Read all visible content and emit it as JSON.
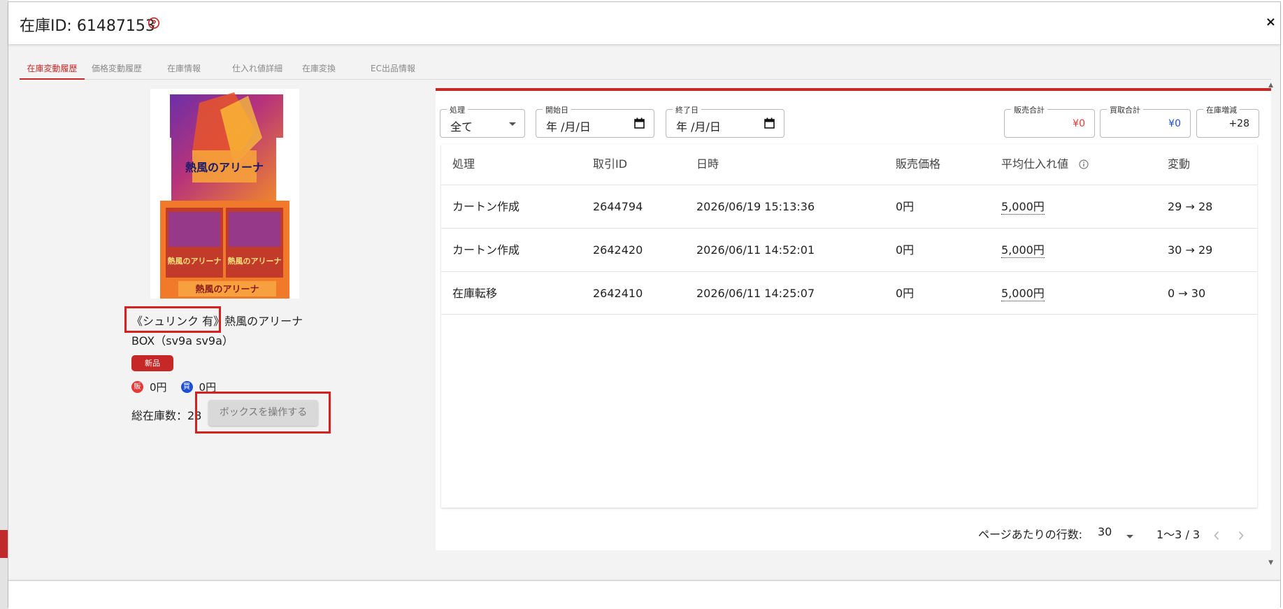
{
  "header": {
    "title": "在庫ID: 61487153",
    "close_label": "×"
  },
  "tabs": [
    {
      "label": "在庫変動履歴",
      "active": true
    },
    {
      "label": "価格変動履歴",
      "active": false
    },
    {
      "label": "在庫情報",
      "active": false
    },
    {
      "label": "仕入れ値詳細",
      "active": false
    },
    {
      "label": "在庫変換",
      "active": false
    },
    {
      "label": "EC出品情報",
      "active": false
    }
  ],
  "product": {
    "name_highlight": "《シュリンク 有》",
    "name_rest": "熱風のアリーナ",
    "name_line2": "BOX（sv9a sv9a）",
    "badge": "新品",
    "sell_icon": "販",
    "buy_icon": "買",
    "sell_price": "0円",
    "buy_price": "0円",
    "stock_label": "総在庫数：28",
    "box_button": "ボックスを操作する",
    "image_text_top": "熱風のアリーナ",
    "image_text_a": "熱風のアリーナ",
    "image_text_b": "熱風のアリーナ"
  },
  "filters": {
    "process": {
      "label": "処理",
      "value": "全て"
    },
    "start_date": {
      "label": "開始日",
      "value": "年 /月/日"
    },
    "end_date": {
      "label": "終了日",
      "value": "年 /月/日"
    },
    "sales_total": {
      "label": "販売合計",
      "value": "¥0"
    },
    "buy_total": {
      "label": "買取合計",
      "value": "¥0"
    },
    "stock_change": {
      "label": "在庫増減",
      "value": "+28"
    }
  },
  "table": {
    "columns": [
      "処理",
      "取引ID",
      "日時",
      "販売価格",
      "平均仕入れ値",
      "変動"
    ],
    "rows": [
      {
        "process": "カートン作成",
        "id": "2644794",
        "datetime": "2026/06/19 15:13:36",
        "price": "0円",
        "avg_cost": "5,000円",
        "change": "29 → 28"
      },
      {
        "process": "カートン作成",
        "id": "2642420",
        "datetime": "2026/06/11 14:52:01",
        "price": "0円",
        "avg_cost": "5,000円",
        "change": "30 → 29"
      },
      {
        "process": "在庫転移",
        "id": "2642410",
        "datetime": "2026/06/11 14:25:07",
        "price": "0円",
        "avg_cost": "5,000円",
        "change": "0 → 30"
      }
    ]
  },
  "pagination": {
    "rows_label": "ページあたりの行数:",
    "rows_value": "30",
    "range": "1～3 / 3"
  },
  "colors": {
    "accent": "#c62828",
    "sales": "#e53935",
    "buy": "#1e4fd6"
  },
  "icons": [
    "help-circle-icon",
    "close-icon",
    "caret-down-icon",
    "calendar-icon",
    "info-icon",
    "chevron-left-icon",
    "chevron-right-icon"
  ]
}
